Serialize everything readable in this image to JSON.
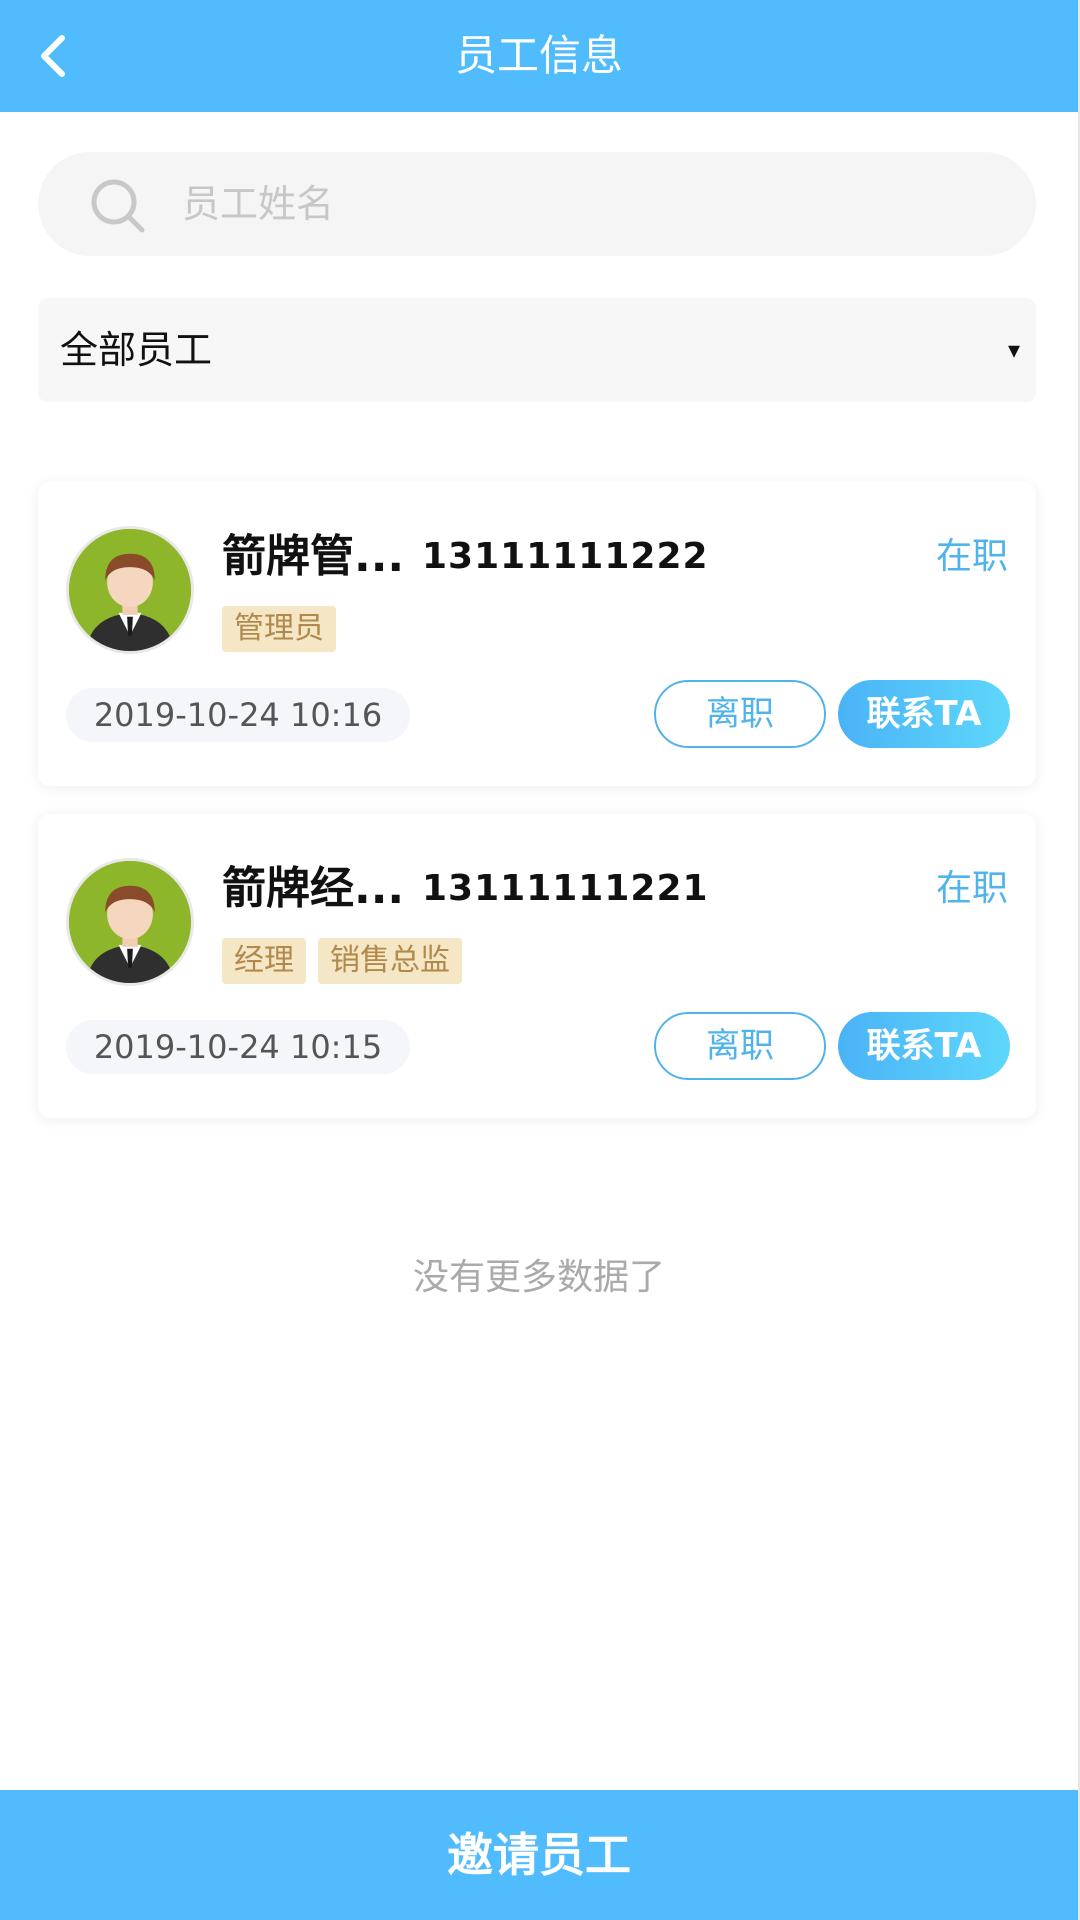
{
  "header": {
    "title": "员工信息",
    "back_icon": "chevron-left-icon"
  },
  "search": {
    "placeholder": "员工姓名",
    "value": "",
    "icon": "search-icon"
  },
  "filter": {
    "selected": "全部员工",
    "caret": "▾"
  },
  "employees": [
    {
      "name": "箭牌管...",
      "phone": "13111111222",
      "status": "在职",
      "tags": [
        "管理员"
      ],
      "date": "2019-10-24 10:16",
      "resign_label": "离职",
      "contact_label": "联系TA"
    },
    {
      "name": "箭牌经...",
      "phone": "13111111221",
      "status": "在职",
      "tags": [
        "经理",
        "销售总监"
      ],
      "date": "2019-10-24 10:15",
      "resign_label": "离职",
      "contact_label": "联系TA"
    }
  ],
  "list_end_text": "没有更多数据了",
  "footer": {
    "invite_label": "邀请员工"
  },
  "colors": {
    "primary": "#50bcfd",
    "status": "#50b4ec",
    "tag_bg": "#f5e6c6",
    "tag_text": "#b08a4a"
  }
}
